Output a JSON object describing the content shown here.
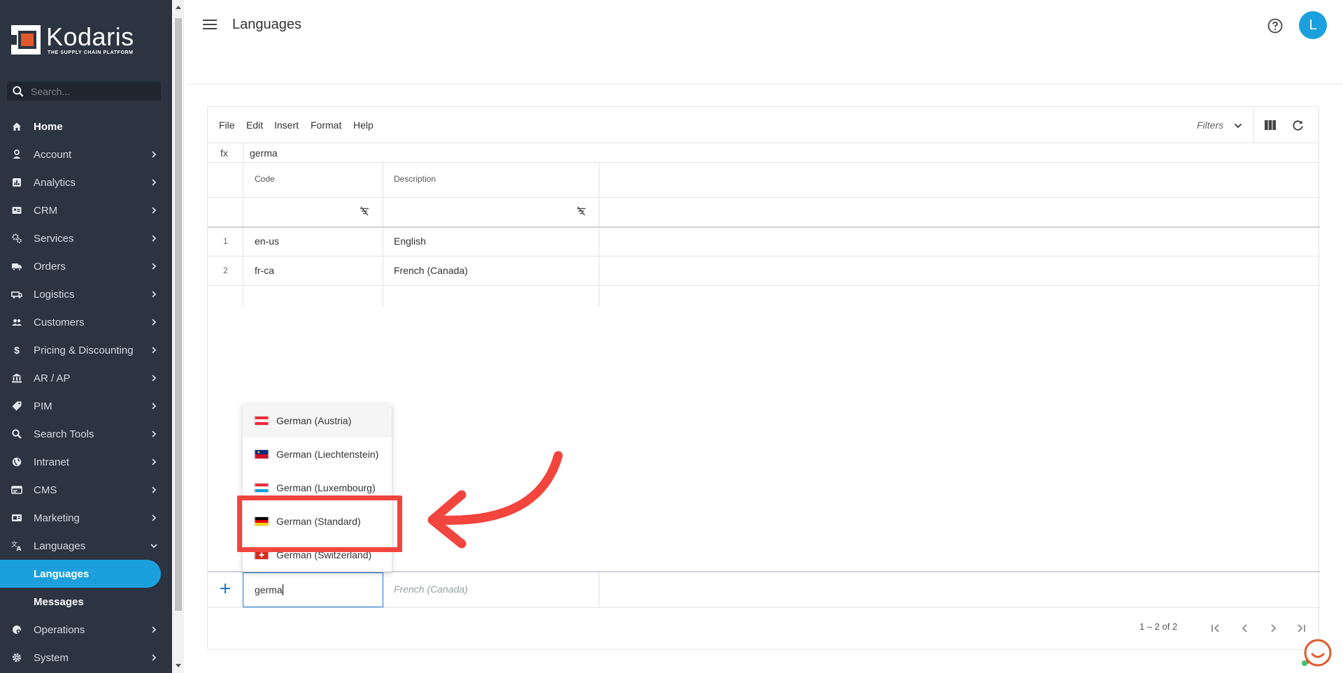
{
  "brand": {
    "name": "Kodaris",
    "tagline": "THE SUPPLY CHAIN PLATFORM"
  },
  "sidebar": {
    "search_placeholder": "Search...",
    "items": [
      {
        "label": "Home",
        "icon": "home-icon"
      },
      {
        "label": "Account",
        "icon": "person-icon"
      },
      {
        "label": "Analytics",
        "icon": "analytics-icon"
      },
      {
        "label": "CRM",
        "icon": "crm-icon"
      },
      {
        "label": "Services",
        "icon": "services-icon"
      },
      {
        "label": "Orders",
        "icon": "truck-icon"
      },
      {
        "label": "Logistics",
        "icon": "logistics-icon"
      },
      {
        "label": "Customers",
        "icon": "customers-icon"
      },
      {
        "label": "Pricing & Discounting",
        "icon": "dollar-icon"
      },
      {
        "label": "AR / AP",
        "icon": "bank-icon"
      },
      {
        "label": "PIM",
        "icon": "tag-icon"
      },
      {
        "label": "Search Tools",
        "icon": "search-icon"
      },
      {
        "label": "Intranet",
        "icon": "globe-icon"
      },
      {
        "label": "CMS",
        "icon": "cms-icon"
      },
      {
        "label": "Marketing",
        "icon": "marketing-icon"
      },
      {
        "label": "Languages",
        "icon": "translate-icon"
      },
      {
        "label": "Languages"
      },
      {
        "label": "Messages"
      },
      {
        "label": "Operations",
        "icon": "operations-icon"
      },
      {
        "label": "System",
        "icon": "gear-icon"
      }
    ]
  },
  "header": {
    "title": "Languages",
    "avatar_initial": "L"
  },
  "toolbar": {
    "menus": [
      "File",
      "Edit",
      "Insert",
      "Format",
      "Help"
    ],
    "filters_label": "Filters"
  },
  "formula_bar": {
    "label": "fx",
    "value": "germa"
  },
  "grid": {
    "columns": [
      "Code",
      "Description"
    ],
    "rows": [
      {
        "num": "1",
        "code": "en-us",
        "description": "English"
      },
      {
        "num": "2",
        "code": "fr-ca",
        "description": "French (Canada)"
      }
    ],
    "new_row": {
      "code_value": "germa",
      "description_placeholder": "French (Canada)"
    },
    "pager": "1 – 2 of 2"
  },
  "dropdown": {
    "options": [
      {
        "label": "German (Austria)",
        "flag": "austria"
      },
      {
        "label": "German (Liechtenstein)",
        "flag": "liechtenstein"
      },
      {
        "label": "German (Luxembourg)",
        "flag": "luxembourg"
      },
      {
        "label": "German (Standard)",
        "flag": "germany"
      },
      {
        "label": "German (Switzerland)",
        "flag": "switzerland"
      }
    ]
  },
  "colors": {
    "sidebar_bg": "#2b3440",
    "accent": "#1ba0dd",
    "annotation": "#f2453d",
    "input_border": "#1976d2"
  }
}
